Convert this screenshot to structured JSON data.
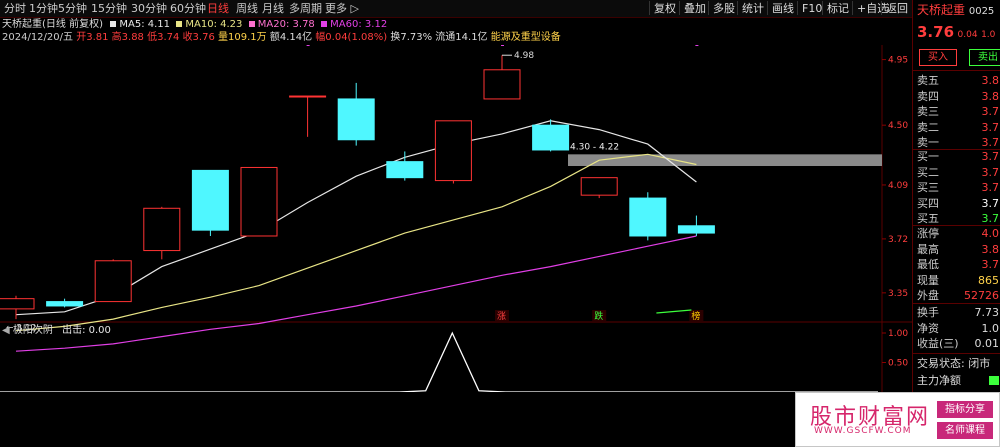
{
  "toolbar": {
    "timeframes": [
      "分时",
      "1分钟",
      "5分钟",
      "15分钟",
      "30分钟",
      "60分钟",
      "日线",
      "周线",
      "月线",
      "多周期",
      "更多 ▷"
    ],
    "active_timeframe": "日线",
    "buttons": [
      "复权",
      "叠加",
      "多股",
      "统计",
      "画线",
      "F10",
      "标记",
      "+自选",
      "返回"
    ]
  },
  "info": {
    "title": "天桥起重(日线 前复权)",
    "ma5": "MA5: 4.11",
    "ma10": "MA10: 4.23",
    "ma20": "MA20: 3.78",
    "ma60": "MA60: 3.12",
    "date": "2024/12/20/五",
    "open": "开3.81",
    "high": "高3.88",
    "low": "低3.74",
    "close": "收3.76",
    "volume": "量109.1万",
    "amount": "额4.14亿",
    "change": "幅0.04(1.08%)",
    "turnover": "换7.73%",
    "float": "流通14.1亿",
    "sector": "能源及重型设备"
  },
  "indicator": {
    "title": "极阳次阴",
    "output_label": "出击: 0.00",
    "axis_ticks": [
      "1.00",
      "0.50"
    ]
  },
  "colors": {
    "up": "#ff3333",
    "down": "#4ff7ff",
    "ma5": "#e6e6e6",
    "ma10": "#e8e486",
    "ma60": "#e13fe6",
    "accent_red": "#ff3d3d"
  },
  "chart_data": {
    "type": "candlestick",
    "y_ticks": [
      "4.95",
      "4.50",
      "4.09",
      "3.72",
      "3.35"
    ],
    "ylim": [
      3.15,
      5.05
    ],
    "candles": [
      {
        "open": 3.24,
        "high": 3.33,
        "low": 3.17,
        "close": 3.31,
        "dir": "up"
      },
      {
        "open": 3.29,
        "high": 3.31,
        "low": 3.25,
        "close": 3.26,
        "dir": "down"
      },
      {
        "open": 3.29,
        "high": 3.58,
        "low": 3.29,
        "close": 3.57,
        "dir": "up"
      },
      {
        "open": 3.64,
        "high": 3.94,
        "low": 3.58,
        "close": 3.93,
        "dir": "up"
      },
      {
        "open": 4.19,
        "high": 4.19,
        "low": 3.74,
        "close": 3.78,
        "dir": "down"
      },
      {
        "open": 3.74,
        "high": 4.21,
        "low": 3.74,
        "close": 4.21,
        "dir": "up"
      },
      {
        "open": 4.7,
        "high": 4.7,
        "low": 4.42,
        "close": 4.7,
        "dir": "up"
      },
      {
        "open": 4.68,
        "high": 4.79,
        "low": 4.36,
        "close": 4.4,
        "dir": "down"
      },
      {
        "open": 4.25,
        "high": 4.32,
        "low": 4.12,
        "close": 4.14,
        "dir": "down"
      },
      {
        "open": 4.12,
        "high": 4.53,
        "low": 4.1,
        "close": 4.53,
        "dir": "up"
      },
      {
        "open": 4.68,
        "high": 4.98,
        "low": 4.68,
        "close": 4.88,
        "dir": "up"
      },
      {
        "open": 4.5,
        "high": 4.54,
        "low": 4.32,
        "close": 4.33,
        "dir": "down"
      },
      {
        "open": 4.02,
        "high": 4.14,
        "low": 4.0,
        "close": 4.14,
        "dir": "up"
      },
      {
        "open": 4.0,
        "high": 4.04,
        "low": 3.71,
        "close": 3.74,
        "dir": "down"
      },
      {
        "open": 3.81,
        "high": 3.88,
        "low": 3.74,
        "close": 3.76,
        "dir": "down"
      }
    ],
    "ma5": [
      3.2,
      3.22,
      3.33,
      3.53,
      3.65,
      3.77,
      3.97,
      4.15,
      4.28,
      4.37,
      4.44,
      4.53,
      4.47,
      4.37,
      4.11
    ],
    "ma10": [
      3.09,
      3.12,
      3.17,
      3.25,
      3.32,
      3.4,
      3.52,
      3.64,
      3.76,
      3.85,
      3.94,
      4.08,
      4.26,
      4.3,
      4.23
    ],
    "ma60": [
      2.95,
      2.97,
      3.0,
      3.05,
      3.1,
      3.14,
      3.2,
      3.26,
      3.33,
      3.4,
      3.47,
      3.53,
      3.6,
      3.67,
      3.74
    ],
    "low_label": "3.12",
    "high_label": "4.98",
    "range_label": "4.30 - 4.22",
    "signals": [
      {
        "index": 10,
        "label": "涨",
        "color": "#ff4040"
      },
      {
        "index": 12,
        "label": "跌",
        "color": "#3cff3c"
      },
      {
        "index": 14,
        "label": "榜",
        "color": "#ffcc00"
      }
    ],
    "indicator_series": [
      0,
      0,
      0,
      0,
      0,
      0,
      0,
      0,
      0,
      0,
      0,
      0,
      0,
      0,
      0,
      0,
      0.02,
      1,
      0.02,
      0,
      0,
      0,
      0,
      0,
      0,
      0,
      0,
      0,
      0,
      0,
      0,
      0,
      0,
      0
    ]
  },
  "quote": {
    "name": "天桥起重",
    "code": "0025",
    "price": "3.76",
    "chg": "0.04",
    "pct": "1.0",
    "buy_btn": "买入",
    "sell_btn": "卖出",
    "asks": [
      {
        "label": "卖五",
        "val": "3.8"
      },
      {
        "label": "卖四",
        "val": "3.8"
      },
      {
        "label": "卖三",
        "val": "3.7"
      },
      {
        "label": "卖二",
        "val": "3.7"
      },
      {
        "label": "卖一",
        "val": "3.7"
      }
    ],
    "bids": [
      {
        "label": "买一",
        "val": "3.7"
      },
      {
        "label": "买二",
        "val": "3.7"
      },
      {
        "label": "买三",
        "val": "3.7"
      },
      {
        "label": "买四",
        "val": "3.7"
      },
      {
        "label": "买五",
        "val": "3.7"
      }
    ],
    "stats": [
      {
        "label": "涨停",
        "val": "4.0"
      },
      {
        "label": "最高",
        "val": "3.8"
      },
      {
        "label": "最低",
        "val": "3.7"
      },
      {
        "label": "现量",
        "val": "865"
      },
      {
        "label": "外盘",
        "val": "52726"
      }
    ],
    "more": [
      {
        "label": "换手",
        "val": "7.73"
      },
      {
        "label": "净资",
        "val": "1.0"
      },
      {
        "label": "收益(三)",
        "val": "0.01"
      }
    ],
    "status_label": "交易状态: 闭市",
    "main_flow": "主力净额"
  },
  "watermark": {
    "title": "股市财富网",
    "url": "WWW.GSCFW.COM",
    "btn1": "指标分享",
    "btn2": "名师课程"
  }
}
